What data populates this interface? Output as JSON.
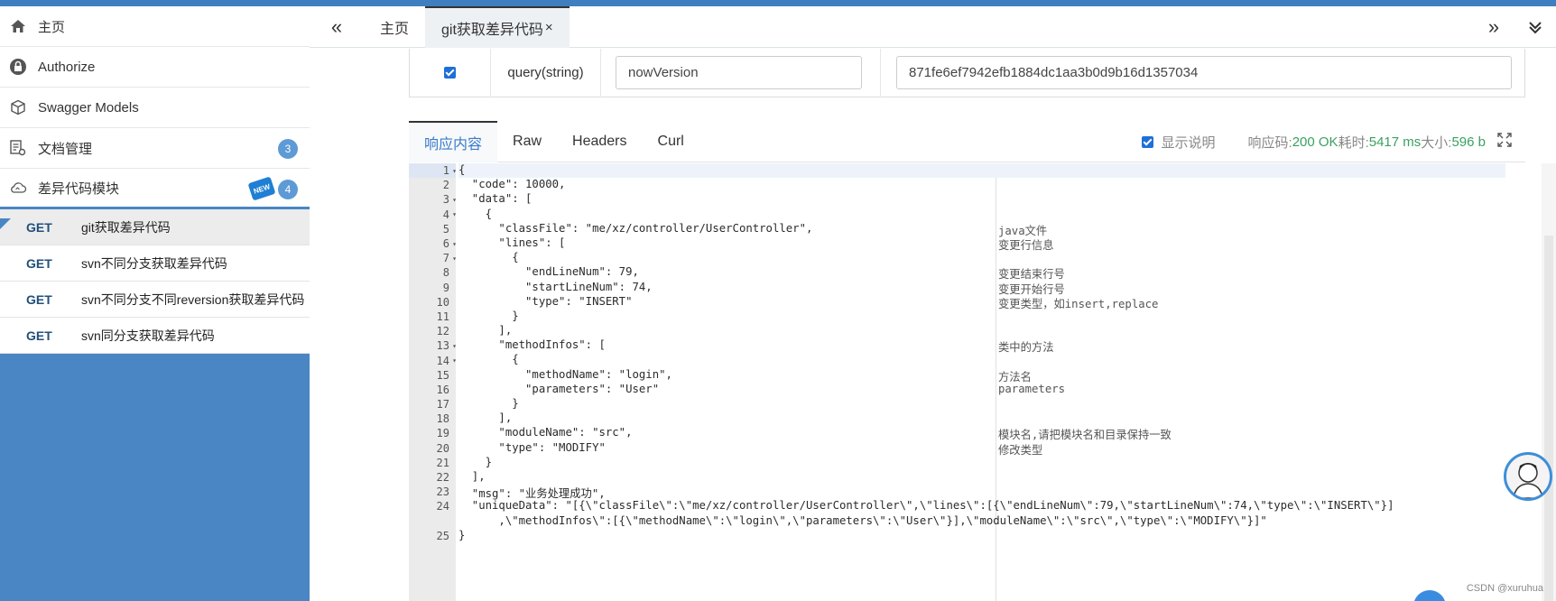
{
  "sidebar": {
    "menu": [
      {
        "label": "主页",
        "icon": "home-icon"
      },
      {
        "label": "Authorize",
        "icon": "lock-icon"
      },
      {
        "label": "Swagger Models",
        "icon": "cube-icon"
      },
      {
        "label": "文档管理",
        "icon": "docs-icon",
        "badge": "3"
      },
      {
        "label": "差异代码模块",
        "icon": "cloud-icon",
        "badge": "4",
        "new": "NEW"
      }
    ],
    "endpoints": [
      {
        "method": "GET",
        "path": "git获取差异代码"
      },
      {
        "method": "GET",
        "path": "svn不同分支获取差异代码"
      },
      {
        "method": "GET",
        "path": "svn不同分支不同reversion获取差异代码"
      },
      {
        "method": "GET",
        "path": "svn同分支获取差异代码"
      }
    ]
  },
  "tabs": {
    "prev": "«",
    "next": "»",
    "items": [
      {
        "label": "主页"
      },
      {
        "label": "git获取差异代码",
        "close": "×"
      }
    ],
    "more": "⌄"
  },
  "param": {
    "type": "query(string)",
    "name": "nowVersion",
    "value": "871fe6ef7942efb1884dc1aa3b0d9b16d1357034"
  },
  "response": {
    "tabs": [
      "响应内容",
      "Raw",
      "Headers",
      "Curl"
    ],
    "show_desc_label": "显示说明",
    "code_label": "响应码:",
    "code_value": "200 OK",
    "time_label": "耗时:",
    "time_value": "5417 ms",
    "size_label": "大小:",
    "size_value": "596 b"
  },
  "code_lines": [
    {
      "n": "1",
      "text": "{",
      "comment": ""
    },
    {
      "n": "2",
      "text": "  \"code\": 10000,",
      "comment": ""
    },
    {
      "n": "3",
      "text": "  \"data\": [",
      "comment": ""
    },
    {
      "n": "4",
      "text": "    {",
      "comment": ""
    },
    {
      "n": "5",
      "text": "      \"classFile\": \"me/xz/controller/UserController\",",
      "comment": "java文件"
    },
    {
      "n": "6",
      "text": "      \"lines\": [",
      "comment": "变更行信息"
    },
    {
      "n": "7",
      "text": "        {",
      "comment": ""
    },
    {
      "n": "8",
      "text": "          \"endLineNum\": 79,",
      "comment": "变更结束行号"
    },
    {
      "n": "9",
      "text": "          \"startLineNum\": 74,",
      "comment": "变更开始行号"
    },
    {
      "n": "10",
      "text": "          \"type\": \"INSERT\"",
      "comment": "变更类型，如insert,replace"
    },
    {
      "n": "11",
      "text": "        }",
      "comment": ""
    },
    {
      "n": "12",
      "text": "      ],",
      "comment": ""
    },
    {
      "n": "13",
      "text": "      \"methodInfos\": [",
      "comment": "类中的方法"
    },
    {
      "n": "14",
      "text": "        {",
      "comment": ""
    },
    {
      "n": "15",
      "text": "          \"methodName\": \"login\",",
      "comment": "方法名"
    },
    {
      "n": "16",
      "text": "          \"parameters\": \"User\"",
      "comment": "parameters"
    },
    {
      "n": "17",
      "text": "        }",
      "comment": ""
    },
    {
      "n": "18",
      "text": "      ],",
      "comment": ""
    },
    {
      "n": "19",
      "text": "      \"moduleName\": \"src\",",
      "comment": "模块名,请把模块名和目录保持一致"
    },
    {
      "n": "20",
      "text": "      \"type\": \"MODIFY\"",
      "comment": "修改类型"
    },
    {
      "n": "21",
      "text": "    }",
      "comment": ""
    },
    {
      "n": "22",
      "text": "  ],",
      "comment": ""
    },
    {
      "n": "23",
      "text": "  \"msg\": \"业务处理成功\",",
      "comment": ""
    },
    {
      "n": "24",
      "text": "  \"uniqueData\": \"[{\\\"classFile\\\":\\\"me/xz/controller/UserController\\\",\\\"lines\\\":[{\\\"endLineNum\\\":79,\\\"startLineNum\\\":74,\\\"type\\\":\\\"INSERT\\\"}]",
      "comment": ""
    },
    {
      "n": "",
      "text": "      ,\\\"methodInfos\\\":[{\\\"methodName\\\":\\\"login\\\",\\\"parameters\\\":\\\"User\\\"}],\\\"moduleName\\\":\\\"src\\\",\\\"type\\\":\\\"MODIFY\\\"}]\"",
      "comment": ""
    },
    {
      "n": "25",
      "text": "}",
      "comment": ""
    }
  ],
  "watermark": "CSDN @xuruhua"
}
